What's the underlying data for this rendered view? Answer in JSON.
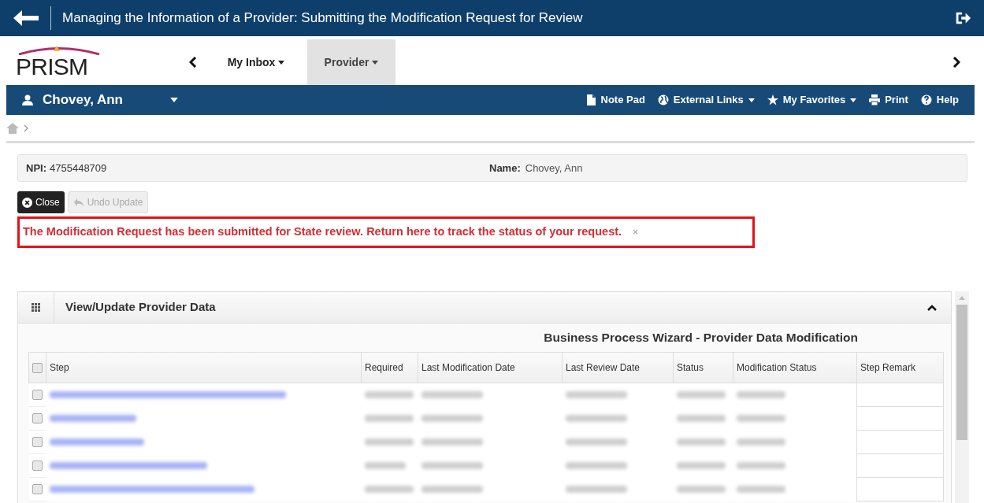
{
  "window": {
    "title": "Managing the Information of a Provider: Submitting the Modification Request for Review"
  },
  "logo": {
    "text": "PRISM"
  },
  "nav_tabs": [
    {
      "label": "My Inbox",
      "selected": false
    },
    {
      "label": "Provider",
      "selected": true
    }
  ],
  "user_bar": {
    "user": "Chovey, Ann",
    "actions": [
      {
        "kind": "notepad",
        "label": "Note Pad",
        "dropdown": false
      },
      {
        "kind": "globe",
        "label": "External Links",
        "dropdown": true
      },
      {
        "kind": "star",
        "label": "My Favorites",
        "dropdown": true
      },
      {
        "kind": "print",
        "label": "Print",
        "dropdown": false
      },
      {
        "kind": "help",
        "label": "Help",
        "dropdown": false
      }
    ]
  },
  "info": {
    "npi_label": "NPI:",
    "npi": "4755448709",
    "name_label": "Name:",
    "name": "Chovey, Ann"
  },
  "buttons": [
    {
      "kind": "close",
      "label": "Close",
      "disabled": false
    },
    {
      "kind": "undo",
      "label": "Undo Update",
      "disabled": true
    }
  ],
  "alert": {
    "message": "The Modification Request has been submitted for State review. Return here to track the status of your request.",
    "dismiss": "×"
  },
  "panel": {
    "title": "View/Update Provider Data",
    "expanded": true,
    "wizard_title": "Business Process Wizard - Provider Data Modification",
    "table": {
      "select_all_checked": false,
      "columns": [
        "Step",
        "Required",
        "Last Modification Date",
        "Last Review Date",
        "Status",
        "Modification Status",
        "Step Remark"
      ],
      "rows": [
        {
          "checked": false
        },
        {
          "checked": false
        },
        {
          "checked": false
        },
        {
          "checked": false
        },
        {
          "checked": false
        }
      ]
    }
  }
}
